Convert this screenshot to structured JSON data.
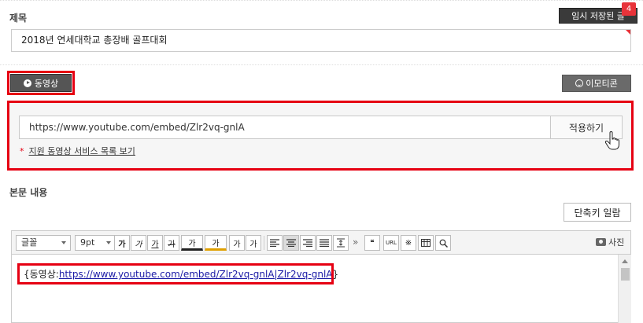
{
  "title_section": {
    "label": "제목",
    "temp_saved_label": "임시 저장된 글",
    "temp_saved_count": "4",
    "title_value": "2018년  연세대학교 총장배 골프대회"
  },
  "media": {
    "video_label": "동영상",
    "emoticon_label": "이모티콘"
  },
  "embed": {
    "url_value": "https://www.youtube.com/embed/Zlr2vq-gnlA",
    "apply_label": "적용하기",
    "support_star": "*",
    "support_link": "지원 동영상 서비스 목록 보기"
  },
  "body_section": {
    "label": "본문 내용",
    "shortcut_label": "단축키 일람"
  },
  "toolbar": {
    "font_select": "글꼴",
    "size_select": "9pt",
    "bold": "가",
    "italic": "가",
    "underline": "가",
    "strike": "가",
    "font_color": "가",
    "highlight": "가",
    "superscript": "가",
    "subscript": "가",
    "more": "»",
    "quote": "❝",
    "url": "URL",
    "special": "※",
    "search": "🔍",
    "photo_label": "사진"
  },
  "editor": {
    "prefix": "{동영상:",
    "link_text": "https://www.youtube.com/embed/Zlr2vq-gnlA",
    "suffix_link": "|Zlr2vq-gnlA",
    "suffix": "}"
  }
}
